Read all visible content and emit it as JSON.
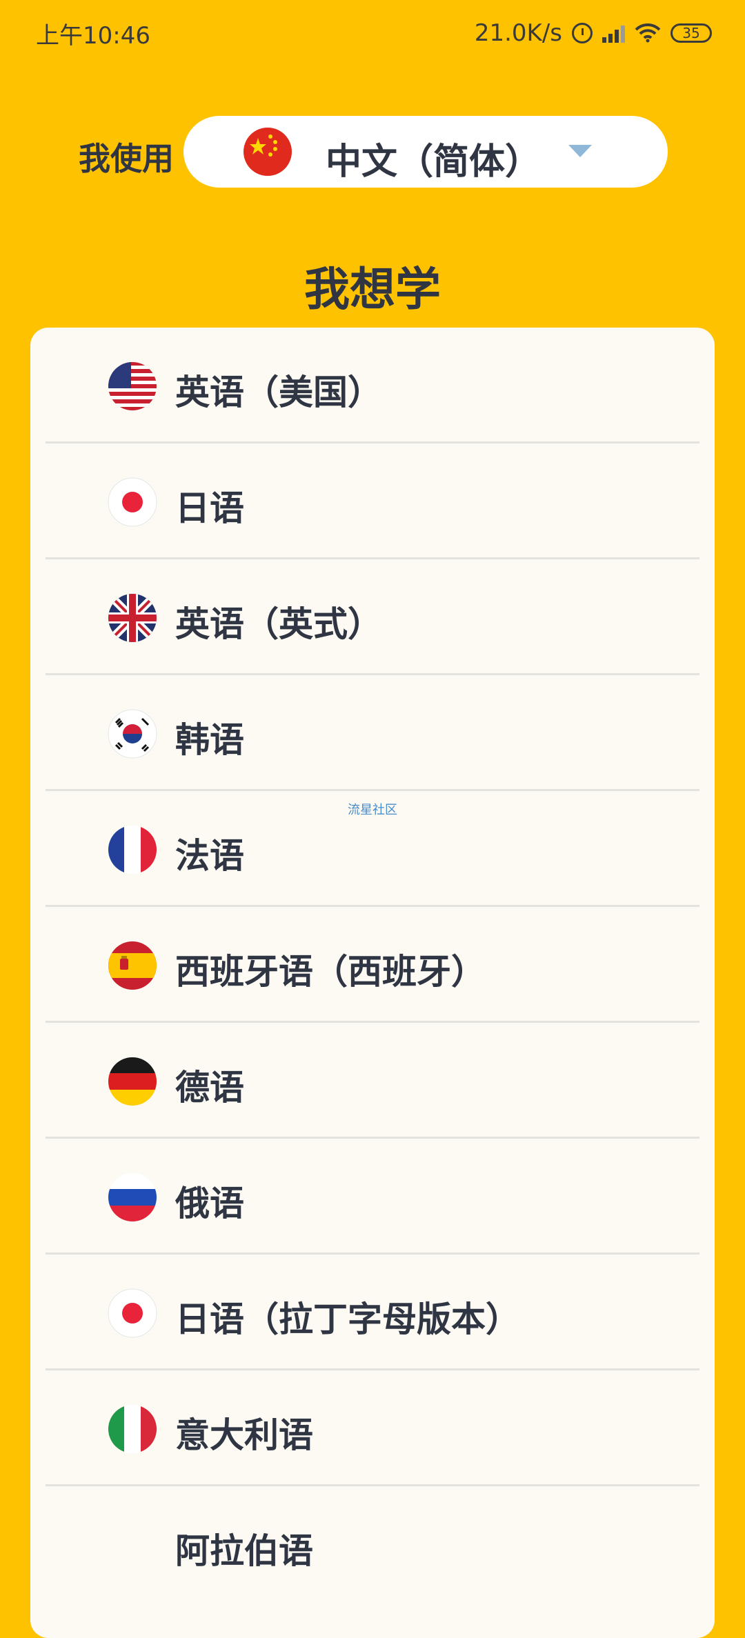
{
  "status": {
    "time": "上午10:46",
    "speed": "21.0K/s",
    "battery": "35"
  },
  "source_language": {
    "label": "我使用",
    "value": "中文（简体）",
    "flag_icon": "china-flag-icon"
  },
  "section_title": "我想学",
  "languages": [
    {
      "name": "英语（美国）",
      "icon": "us-flag-icon"
    },
    {
      "name": "日语",
      "icon": "japan-flag-icon"
    },
    {
      "name": "英语（英式）",
      "icon": "uk-flag-icon"
    },
    {
      "name": "韩语",
      "icon": "korea-flag-icon"
    },
    {
      "name": "法语",
      "icon": "france-flag-icon"
    },
    {
      "name": "西班牙语（西班牙）",
      "icon": "spain-flag-icon"
    },
    {
      "name": "德语",
      "icon": "germany-flag-icon"
    },
    {
      "name": "俄语",
      "icon": "russia-flag-icon"
    },
    {
      "name": "日语（拉丁字母版本）",
      "icon": "japan-flag-icon"
    },
    {
      "name": "意大利语",
      "icon": "italy-flag-icon"
    },
    {
      "name": "阿拉伯语",
      "icon": ""
    }
  ],
  "watermark": "流星社区",
  "colors": {
    "background": "#FFC200",
    "card": "#FCFAF3",
    "text": "#2F3542",
    "caret": "#8FB8D8"
  }
}
